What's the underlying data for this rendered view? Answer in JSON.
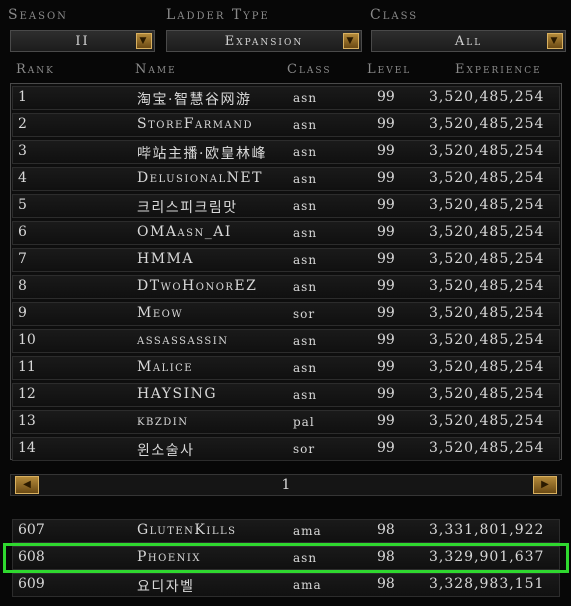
{
  "filters": {
    "season": {
      "label": "Season",
      "value": "II"
    },
    "ladder_type": {
      "label": "Ladder Type",
      "value": "Expansion"
    },
    "class": {
      "label": "Class",
      "value": "All"
    }
  },
  "columns": {
    "rank": "Rank",
    "name": "Name",
    "class": "Class",
    "level": "Level",
    "experience": "Experience"
  },
  "top_rows": [
    {
      "rank": "1",
      "name": "淘宝·智慧谷网游",
      "class": "asn",
      "level": "99",
      "experience": "3,520,485,254"
    },
    {
      "rank": "2",
      "name": "StoreFarmand",
      "class": "asn",
      "level": "99",
      "experience": "3,520,485,254"
    },
    {
      "rank": "3",
      "name": "哔站主播·欧皇林峰",
      "class": "asn",
      "level": "99",
      "experience": "3,520,485,254"
    },
    {
      "rank": "4",
      "name": "DelusionalNET",
      "class": "asn",
      "level": "99",
      "experience": "3,520,485,254"
    },
    {
      "rank": "5",
      "name": "크리스피크림맛",
      "class": "asn",
      "level": "99",
      "experience": "3,520,485,254"
    },
    {
      "rank": "6",
      "name": "OMAasn_AI",
      "class": "asn",
      "level": "99",
      "experience": "3,520,485,254"
    },
    {
      "rank": "7",
      "name": "HMMA",
      "class": "asn",
      "level": "99",
      "experience": "3,520,485,254"
    },
    {
      "rank": "8",
      "name": "DTwoHonorEZ",
      "class": "asn",
      "level": "99",
      "experience": "3,520,485,254"
    },
    {
      "rank": "9",
      "name": "Meow",
      "class": "sor",
      "level": "99",
      "experience": "3,520,485,254"
    },
    {
      "rank": "10",
      "name": "assassassin",
      "class": "asn",
      "level": "99",
      "experience": "3,520,485,254"
    },
    {
      "rank": "11",
      "name": "Malice",
      "class": "asn",
      "level": "99",
      "experience": "3,520,485,254"
    },
    {
      "rank": "12",
      "name": "HAYSING",
      "class": "asn",
      "level": "99",
      "experience": "3,520,485,254"
    },
    {
      "rank": "13",
      "name": "kbzdin",
      "class": "pal",
      "level": "99",
      "experience": "3,520,485,254"
    },
    {
      "rank": "14",
      "name": "윈소술사",
      "class": "sor",
      "level": "99",
      "experience": "3,520,485,254"
    }
  ],
  "pager": {
    "page": "1",
    "prev_icon": "left-arrow-icon",
    "next_icon": "right-arrow-icon"
  },
  "player_rows": [
    {
      "rank": "607",
      "name": "GlutenKills",
      "class": "ama",
      "level": "98",
      "experience": "3,331,801,922"
    },
    {
      "rank": "608",
      "name": "Phoenix",
      "class": "asn",
      "level": "98",
      "experience": "3,329,901,637"
    },
    {
      "rank": "609",
      "name": "요디자벨",
      "class": "ama",
      "level": "98",
      "experience": "3,328,983,151"
    }
  ],
  "colors": {
    "highlight": "#2fd82f",
    "button_gold": "#b48a3a"
  }
}
